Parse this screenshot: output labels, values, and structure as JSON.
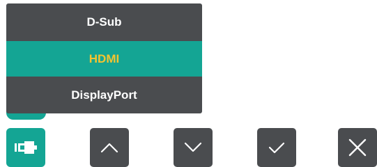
{
  "input_menu": {
    "items": [
      {
        "label": "D-Sub",
        "selected": false
      },
      {
        "label": "HDMI",
        "selected": true
      },
      {
        "label": "DisplayPort",
        "selected": false
      }
    ]
  },
  "buttons": [
    {
      "icon": "input-source-icon",
      "active": true
    },
    {
      "icon": "chevron-up-icon",
      "active": false
    },
    {
      "icon": "chevron-down-icon",
      "active": false
    },
    {
      "icon": "checkmark-icon",
      "active": false
    },
    {
      "icon": "close-icon",
      "active": false
    }
  ],
  "colors": {
    "panel": "#4a4c4f",
    "accent": "#14a594",
    "selected_text": "#f4c430",
    "text": "#ffffff"
  }
}
